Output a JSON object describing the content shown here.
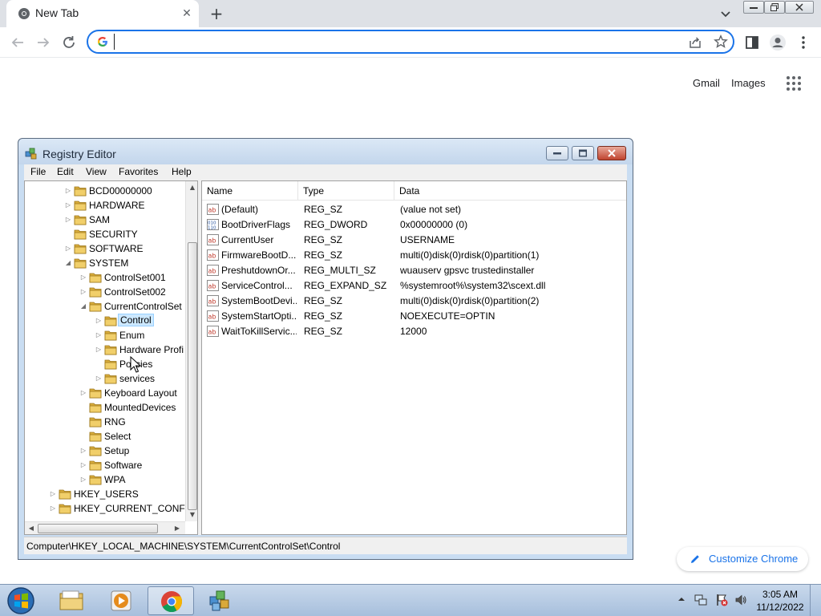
{
  "browser": {
    "tab_title": "New Tab",
    "omnibox_value": "",
    "ntp": {
      "gmail": "Gmail",
      "images": "Images",
      "customize": "Customize Chrome"
    }
  },
  "regedit": {
    "title": "Registry Editor",
    "menu": [
      "File",
      "Edit",
      "View",
      "Favorites",
      "Help"
    ],
    "tree": [
      {
        "label": "BCD00000000",
        "level": 1,
        "expander": "collapsed"
      },
      {
        "label": "HARDWARE",
        "level": 1,
        "expander": "collapsed"
      },
      {
        "label": "SAM",
        "level": 1,
        "expander": "collapsed"
      },
      {
        "label": "SECURITY",
        "level": 1,
        "expander": "none"
      },
      {
        "label": "SOFTWARE",
        "level": 1,
        "expander": "collapsed"
      },
      {
        "label": "SYSTEM",
        "level": 1,
        "expander": "expanded"
      },
      {
        "label": "ControlSet001",
        "level": 2,
        "expander": "collapsed"
      },
      {
        "label": "ControlSet002",
        "level": 2,
        "expander": "collapsed"
      },
      {
        "label": "CurrentControlSet",
        "level": 2,
        "expander": "expanded"
      },
      {
        "label": "Control",
        "level": 3,
        "expander": "collapsed",
        "selected": true
      },
      {
        "label": "Enum",
        "level": 3,
        "expander": "collapsed"
      },
      {
        "label": "Hardware Profi",
        "level": 3,
        "expander": "collapsed"
      },
      {
        "label": "Policies",
        "level": 3,
        "expander": "none"
      },
      {
        "label": "services",
        "level": 3,
        "expander": "collapsed"
      },
      {
        "label": "Keyboard Layout",
        "level": 2,
        "expander": "collapsed"
      },
      {
        "label": "MountedDevices",
        "level": 2,
        "expander": "none"
      },
      {
        "label": "RNG",
        "level": 2,
        "expander": "none"
      },
      {
        "label": "Select",
        "level": 2,
        "expander": "none"
      },
      {
        "label": "Setup",
        "level": 2,
        "expander": "collapsed"
      },
      {
        "label": "Software",
        "level": 2,
        "expander": "collapsed"
      },
      {
        "label": "WPA",
        "level": 2,
        "expander": "collapsed"
      },
      {
        "label": "HKEY_USERS",
        "level": 0,
        "expander": "collapsed"
      },
      {
        "label": "HKEY_CURRENT_CONFIG",
        "level": 0,
        "expander": "collapsed"
      }
    ],
    "columns": [
      "Name",
      "Type",
      "Data"
    ],
    "values": [
      {
        "icon": "string",
        "name": "(Default)",
        "type": "REG_SZ",
        "data": "(value not set)"
      },
      {
        "icon": "binary",
        "name": "BootDriverFlags",
        "type": "REG_DWORD",
        "data": "0x00000000 (0)"
      },
      {
        "icon": "string",
        "name": "CurrentUser",
        "type": "REG_SZ",
        "data": "USERNAME"
      },
      {
        "icon": "string",
        "name": "FirmwareBootD...",
        "type": "REG_SZ",
        "data": "multi(0)disk(0)rdisk(0)partition(1)"
      },
      {
        "icon": "string",
        "name": "PreshutdownOr...",
        "type": "REG_MULTI_SZ",
        "data": "wuauserv gpsvc trustedinstaller"
      },
      {
        "icon": "string",
        "name": "ServiceControl...",
        "type": "REG_EXPAND_SZ",
        "data": "%systemroot%\\system32\\scext.dll"
      },
      {
        "icon": "string",
        "name": "SystemBootDevi...",
        "type": "REG_SZ",
        "data": "multi(0)disk(0)rdisk(0)partition(2)"
      },
      {
        "icon": "string",
        "name": "SystemStartOpti...",
        "type": "REG_SZ",
        "data": " NOEXECUTE=OPTIN"
      },
      {
        "icon": "string",
        "name": "WaitToKillServic...",
        "type": "REG_SZ",
        "data": "12000"
      }
    ],
    "status_path": "Computer\\HKEY_LOCAL_MACHINE\\SYSTEM\\CurrentControlSet\\Control"
  },
  "taskbar": {
    "apps": [
      "file-explorer",
      "media-player",
      "chrome",
      "registry-editor"
    ],
    "active_app": "chrome",
    "clock_time": "3:05 AM",
    "clock_date": "11/12/2022"
  },
  "colors": {
    "accent": "#1a73e8",
    "selection": "#cce8ff",
    "folder": "#e8c04a"
  }
}
